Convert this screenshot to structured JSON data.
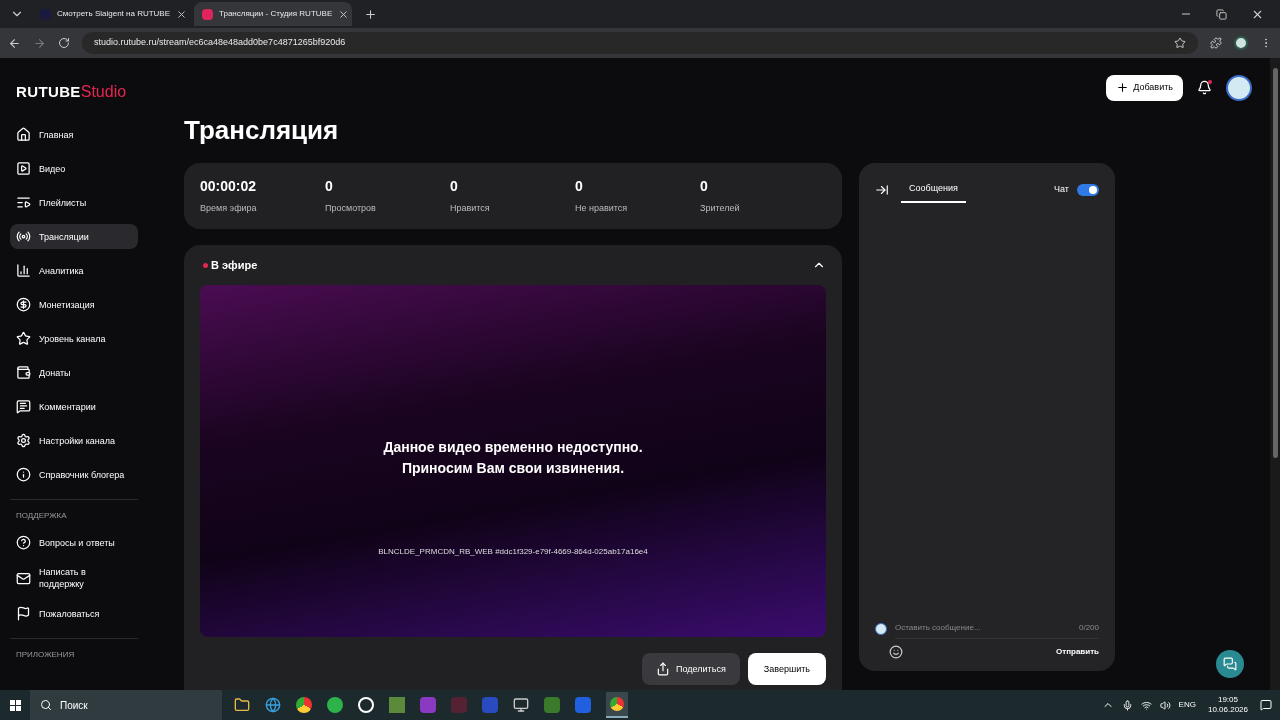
{
  "browser": {
    "tabs": [
      {
        "title": "Смотреть Slaigent на RUTUBE",
        "selected": false
      },
      {
        "title": "Трансляции - Студия RUTUBE",
        "selected": true
      }
    ],
    "url": "studio.rutube.ru/stream/ec6ca48e48add0be7c4871265bf920d6"
  },
  "logo": {
    "brand": "RUTUBE",
    "product": "Studio"
  },
  "header": {
    "add_button": "Добавить",
    "notification": true
  },
  "sidebar": {
    "items": [
      {
        "label": "Главная",
        "selected": false
      },
      {
        "label": "Видео",
        "selected": false
      },
      {
        "label": "Плейлисты",
        "selected": false
      },
      {
        "label": "Трансляции",
        "selected": true
      },
      {
        "label": "Аналитика",
        "selected": false
      },
      {
        "label": "Монетизация",
        "selected": false
      },
      {
        "label": "Уровень канала",
        "selected": false
      },
      {
        "label": "Донаты",
        "selected": false
      },
      {
        "label": "Комментарии",
        "selected": false
      },
      {
        "label": "Настройки канала",
        "selected": false
      },
      {
        "label": "Справочник блогера",
        "selected": false
      }
    ],
    "support_title": "ПОДДЕРЖКА",
    "support_items": [
      {
        "label": "Вопросы и ответы",
        "selected": false
      },
      {
        "label": "Написать в поддержку",
        "selected": false
      },
      {
        "label": "Пожаловаться",
        "selected": false
      }
    ],
    "apps_title": "ПРИЛОЖЕНИЯ"
  },
  "page_title": "Трансляция",
  "stats": [
    {
      "value": "00:00:02",
      "label": "Время эфира"
    },
    {
      "value": "0",
      "label": "Просмотров"
    },
    {
      "value": "0",
      "label": "Нравится"
    },
    {
      "value": "0",
      "label": "Не нравится"
    },
    {
      "value": "0",
      "label": "Зрителей"
    }
  ],
  "live": {
    "title": "В эфире",
    "expanded": true,
    "player": {
      "message": [
        "Данное видео временно недоступно.",
        "Приносим Вам свои извинения."
      ],
      "code": "BLNCLDE_PRMCDN_RB_WEB #ddc1f329-e79f-4669-864d-025ab17a16e4"
    },
    "buttons": [
      {
        "label": "Поделиться",
        "kind": "secondary"
      },
      {
        "label": "Завершить",
        "kind": "primary"
      }
    ]
  },
  "chat": {
    "tabs": [
      {
        "label": "Сообщения",
        "selected": true
      }
    ],
    "toggle_label": "Чат",
    "on": true,
    "input": {
      "placeholder": "Оставить сообщение...",
      "counter": "0/200"
    },
    "send": "Отправить"
  },
  "taskbar": {
    "search": "Поиск",
    "lang": "ENG",
    "time": "19:05",
    "date": "10.06.2026"
  }
}
